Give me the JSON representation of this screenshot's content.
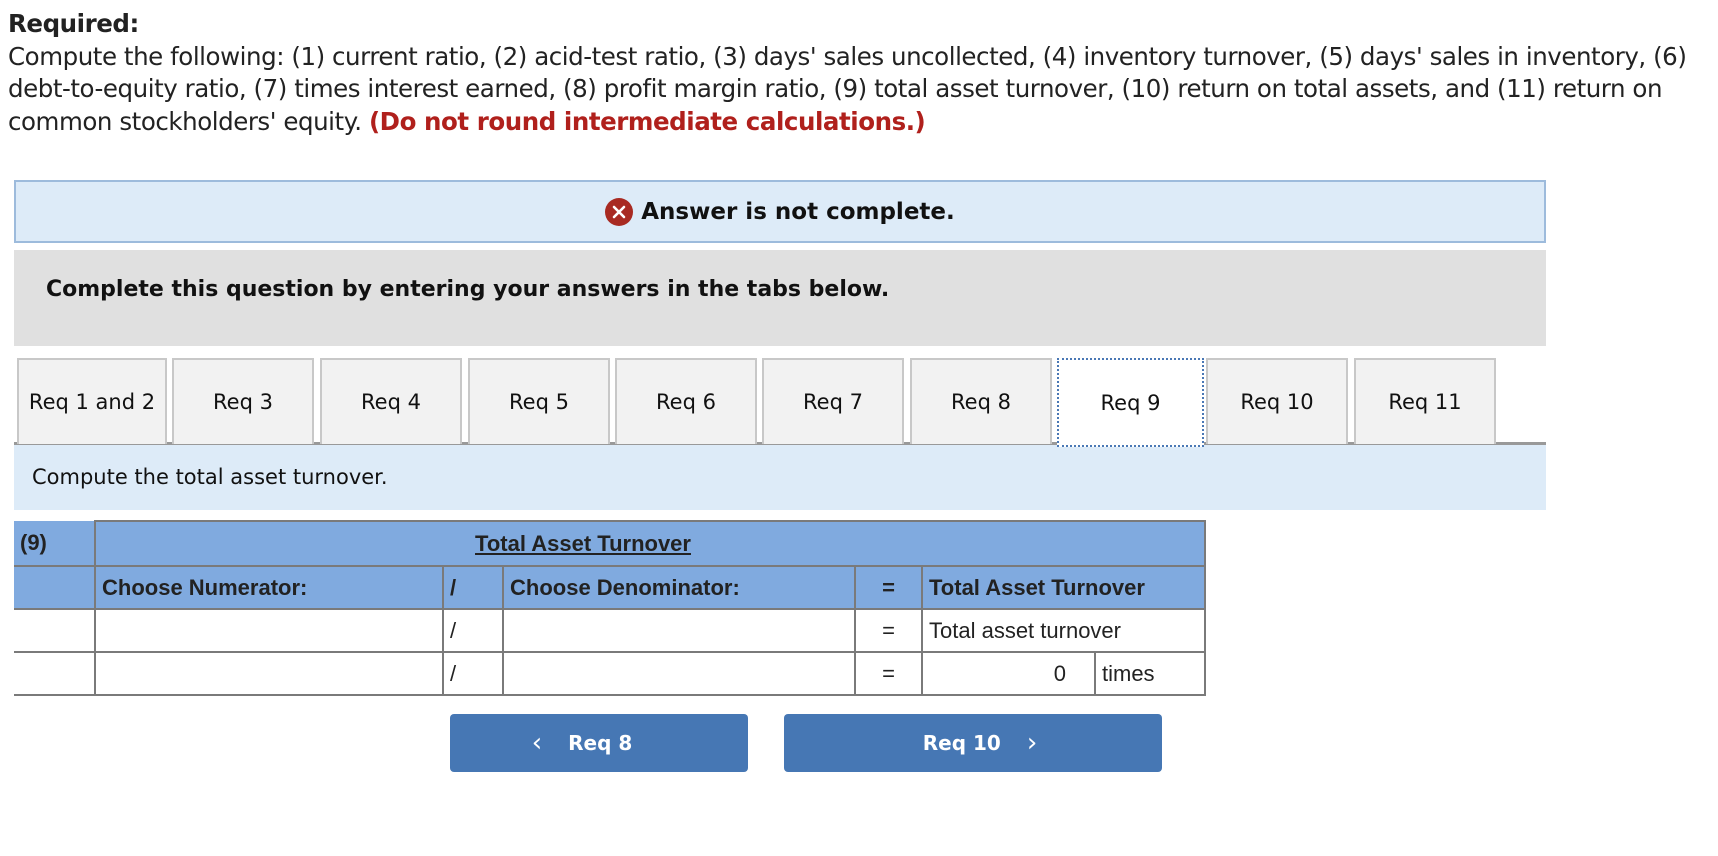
{
  "required": {
    "title": "Required:",
    "body": "Compute the following: (1) current ratio, (2) acid-test ratio, (3) days' sales uncollected, (4) inventory turnover, (5) days' sales in inventory, (6) debt-to-equity ratio, (7) times interest earned, (8) profit margin ratio, (9) total asset turnover, (10) return on total assets, and (11) return on common stockholders' equity.",
    "warning": "(Do not round intermediate calculations.)"
  },
  "status": {
    "icon": "x-circle-icon",
    "message": "Answer is not complete.",
    "icon_color": "#a82a22"
  },
  "instructions": "Complete this question by entering your answers in the tabs below.",
  "tabs": [
    {
      "label": "Req 1 and 2",
      "active": false
    },
    {
      "label": "Req 3",
      "active": false
    },
    {
      "label": "Req 4",
      "active": false
    },
    {
      "label": "Req 5",
      "active": false
    },
    {
      "label": "Req 6",
      "active": false
    },
    {
      "label": "Req 7",
      "active": false
    },
    {
      "label": "Req 8",
      "active": false
    },
    {
      "label": "Req 9",
      "active": true
    },
    {
      "label": "Req 10",
      "active": false
    },
    {
      "label": "Req 11",
      "active": false
    }
  ],
  "prompt": "Compute the total asset turnover.",
  "table": {
    "number": "(9)",
    "title": "Total Asset Turnover",
    "headers": {
      "numerator": "Choose Numerator:",
      "divide": "/",
      "denominator": "Choose Denominator:",
      "equals": "=",
      "result": "Total Asset Turnover"
    },
    "rows": [
      {
        "numerator": "",
        "divide": "/",
        "denominator": "",
        "equals": "=",
        "result": "Total asset turnover"
      },
      {
        "numerator": "",
        "divide": "/",
        "denominator": "",
        "equals": "=",
        "result": "0",
        "unit": "times"
      }
    ]
  },
  "nav": {
    "prev_label": "Req 8",
    "next_label": "Req 10"
  },
  "colors": {
    "header_blue": "#80aadf",
    "button_blue": "#4677b4",
    "warning_red": "#b0201c"
  }
}
